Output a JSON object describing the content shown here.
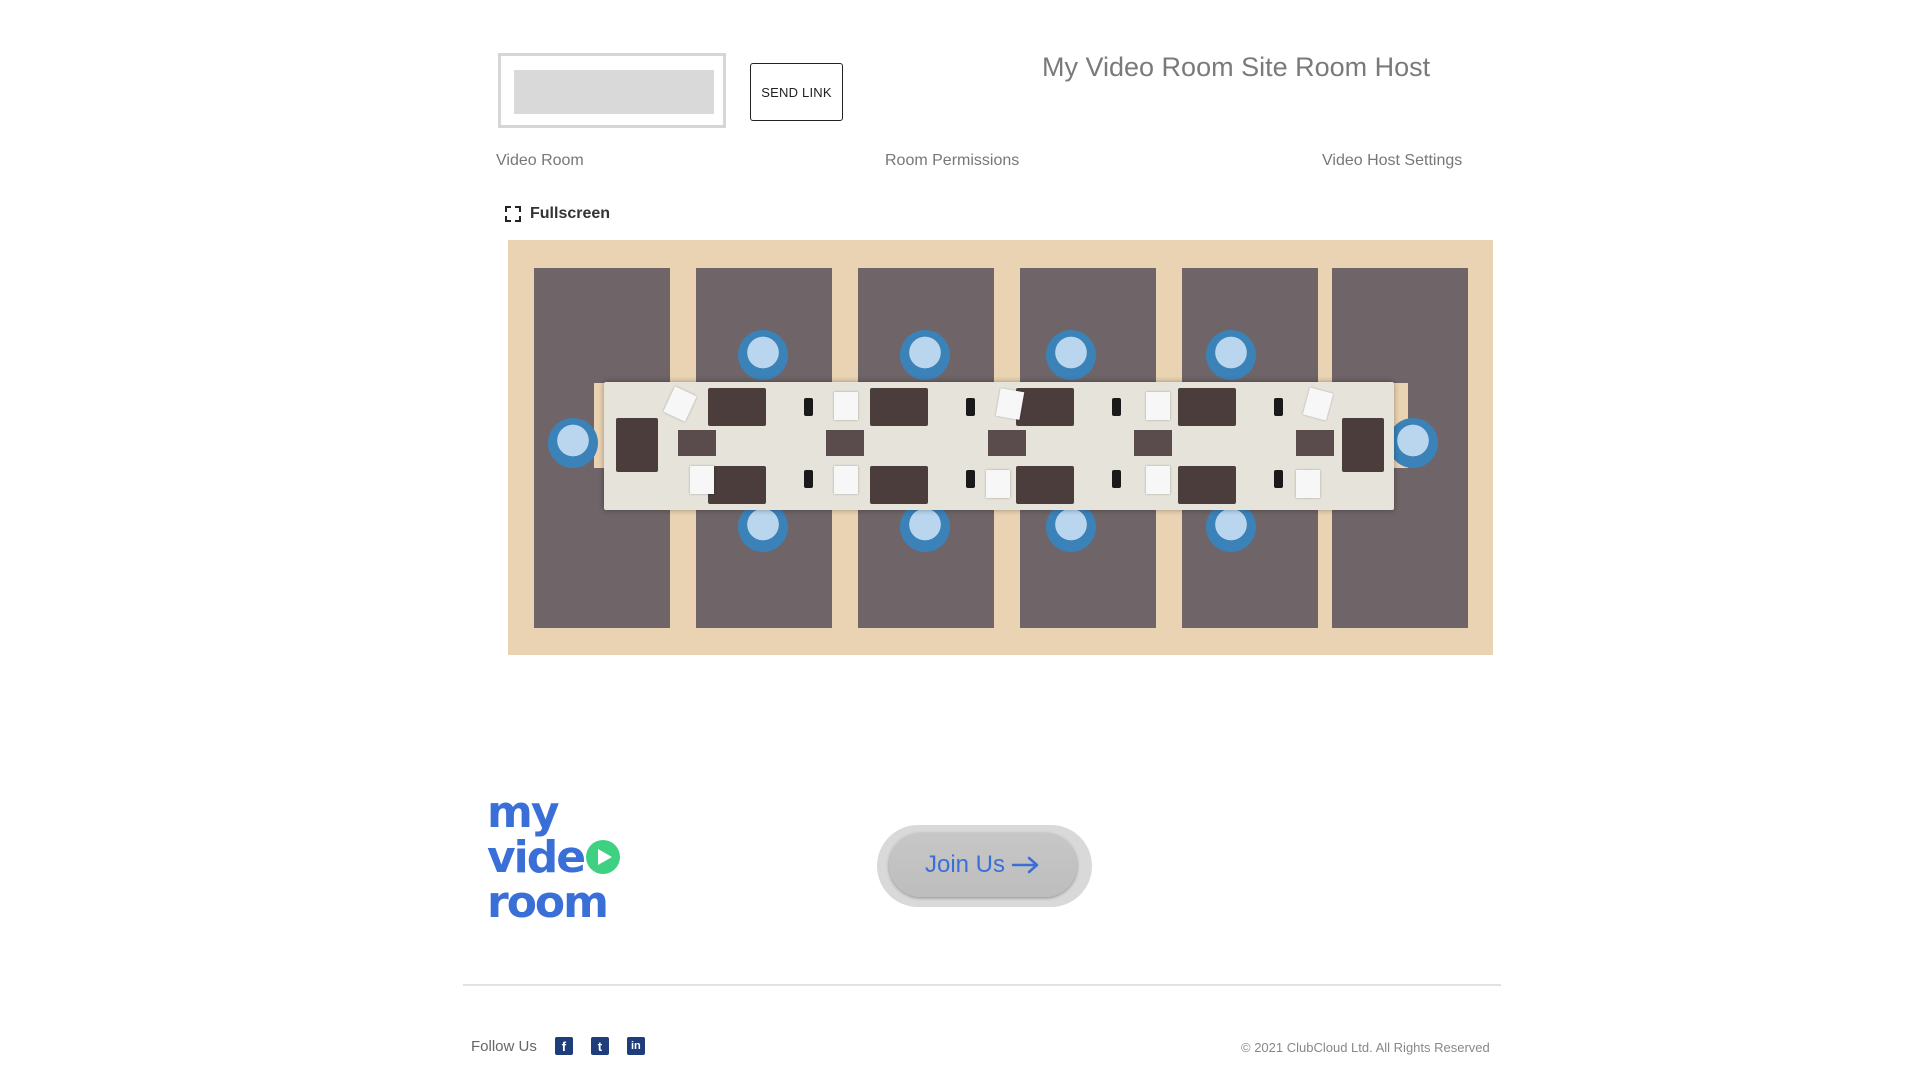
{
  "header": {
    "send_link_label": "SEND LINK",
    "title": "My Video Room Site Room Host"
  },
  "tabs": [
    {
      "label": "Video Room"
    },
    {
      "label": "Room Permissions"
    },
    {
      "label": "Video Host Settings"
    }
  ],
  "viewer": {
    "fullscreen_label": "Fullscreen",
    "fullscreen_icon": "expand-icon"
  },
  "footer": {
    "logo_lines": [
      "my",
      "vide",
      "room"
    ],
    "join_label": "Join Us",
    "join_icon": "arrow-right-icon",
    "follow_label": "Follow Us",
    "social": [
      {
        "icon": "facebook-icon",
        "glyph": "f"
      },
      {
        "icon": "twitter-icon",
        "glyph": "t"
      },
      {
        "icon": "linkedin-icon",
        "glyph": "in"
      }
    ],
    "copyright": "© 2021 ClubCloud Ltd. All Rights Reserved"
  },
  "colors": {
    "brand_blue": "#3b6fd8",
    "play_green": "#3fd182",
    "chair_blue": "#3b82b8",
    "rug": "#6f6467",
    "floor": "#e9d3b2"
  }
}
